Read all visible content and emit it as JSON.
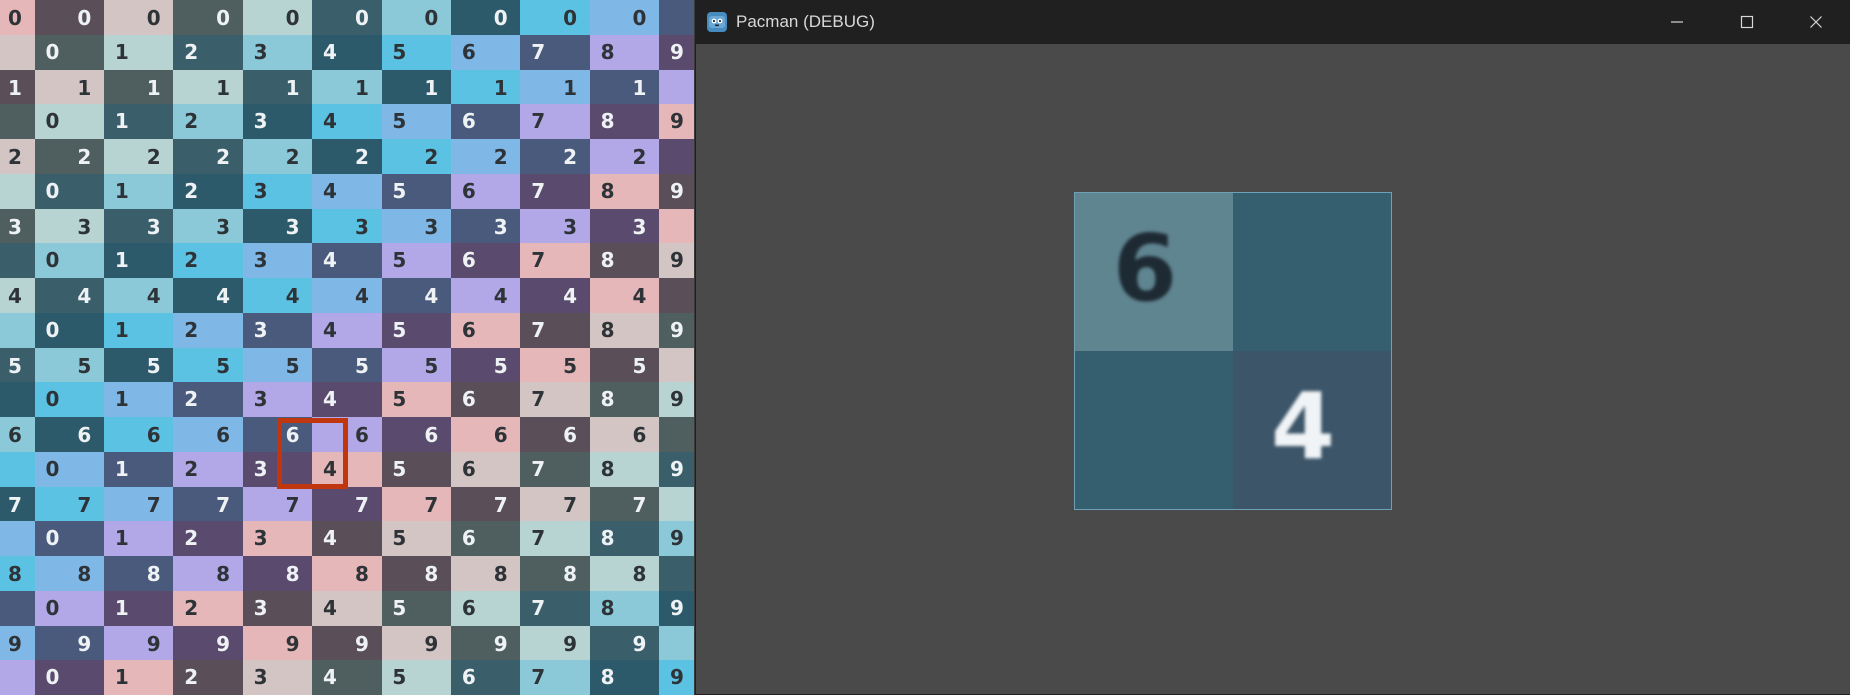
{
  "atlas": {
    "rows": [
      "0",
      "1",
      "2",
      "3",
      "4",
      "5",
      "6",
      "7",
      "8",
      "9"
    ],
    "cols": [
      "0",
      "1",
      "2",
      "3",
      "4",
      "5",
      "6",
      "7",
      "8",
      "9"
    ],
    "selected": {
      "row": 6,
      "col": 4
    }
  },
  "window": {
    "title": "Pacman (DEBUG)",
    "icon": "godot-icon",
    "controls": {
      "minimize_icon": "minimize-icon",
      "maximize_icon": "maximize-icon",
      "close_icon": "close-icon"
    }
  },
  "sprite": {
    "row_digit": "6",
    "col_digit": "4",
    "colors": {
      "top_left": "#5f8591",
      "top_right": "#355e6f",
      "bottom_left": "#355e6f",
      "bottom_right": "#3c5569"
    }
  },
  "colors": {
    "titlebar": "#202020",
    "viewport": "#4a4a4a",
    "highlight": "#c0360f",
    "palette": [
      "#e6b7b9",
      "#5a4f58",
      "#d3c5c3",
      "#4f5e5f",
      "#b7d3d2",
      "#3a5f6b",
      "#8cc9d8",
      "#2d5a6b",
      "#5cc2e3",
      "#7fb7e6",
      "#4a5a7c",
      "#b2a8e8",
      "#5a4a6e"
    ]
  }
}
